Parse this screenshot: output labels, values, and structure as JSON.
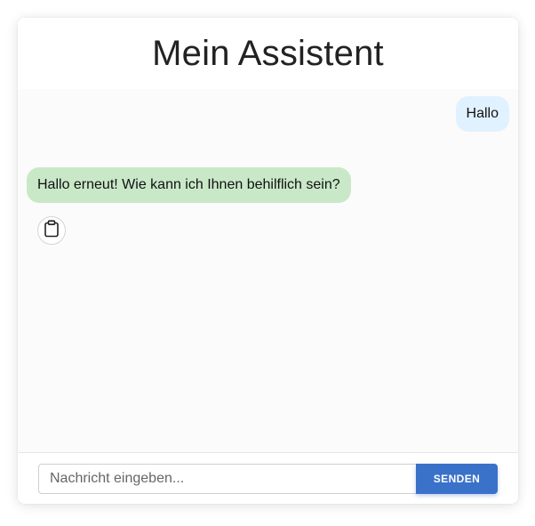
{
  "app": {
    "title": "Mein Assistent"
  },
  "messages": [
    {
      "role": "user",
      "text": "Hallo"
    },
    {
      "role": "assistant",
      "text": "Hallo erneut! Wie kann ich Ihnen behilflich sein?"
    }
  ],
  "actions": {
    "copy_icon": "clipboard-icon"
  },
  "composer": {
    "placeholder": "Nachricht eingeben...",
    "value": "",
    "send_label": "SENDEN"
  },
  "colors": {
    "user_bubble": "#e0f2ff",
    "assistant_bubble": "#c9e8c8",
    "send_button": "#3a71c9"
  }
}
